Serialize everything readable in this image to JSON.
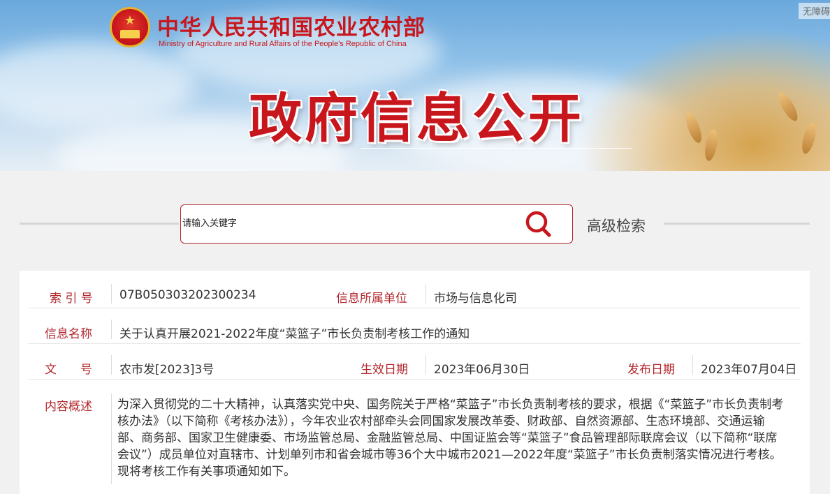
{
  "header": {
    "ministry_name_cn": "中华人民共和国农业农村部",
    "ministry_name_en": "Ministry of Agriculture and Rural Affairs of the People's Republic of China",
    "banner_title": "政府信息公开",
    "accessibility_label": "无障碍"
  },
  "search": {
    "placeholder": "请输入关键字",
    "advanced_label": "高级检索"
  },
  "info": {
    "index_label": "索 引 号",
    "index_value": "07B050303202300234",
    "unit_label": "信息所属单位",
    "unit_value": "市场与信息化司",
    "name_label": "信息名称",
    "name_value": "关于认真开展2021-2022年度“菜篮子”市长负责制考核工作的通知",
    "doc_label": "文　　号",
    "doc_value": "农市发[2023]3号",
    "effective_label": "生效日期",
    "effective_value": "2023年06月30日",
    "publish_label": "发布日期",
    "publish_value": "2023年07月04日",
    "summary_label": "内容概述",
    "summary_text": "为深入贯彻党的二十大精神，认真落实党中央、国务院关于严格“菜篮子”市长负责制考核的要求，根据《“菜篮子”市长负责制考核办法》（以下简称《考核办法》），今年农业农村部牵头会同国家发展改革委、财政部、自然资源部、生态环境部、交通运输部、商务部、国家卫生健康委、市场监管总局、金融监管总局、中国证监会等“菜篮子”食品管理部际联席会议（以下简称“联席会议”）成员单位对直辖市、计划单列市和省会城市等36个大中城市2021—2022年度“菜篮子”市长负责制落实情况进行考核。现将考核工作有关事项通知如下。"
  },
  "colors": {
    "accent_red": "#c8161d",
    "label_red": "#b3272d",
    "body_text": "#333333"
  },
  "icons": [
    "national-emblem-icon",
    "search-icon"
  ]
}
